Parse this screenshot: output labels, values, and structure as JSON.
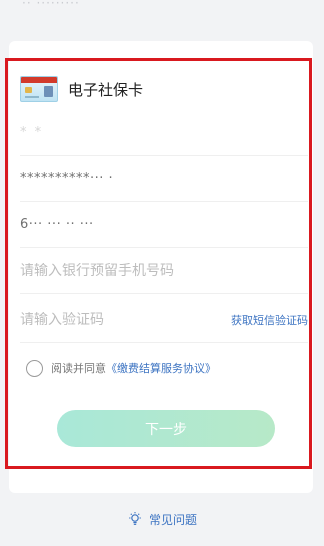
{
  "card": {
    "title": "电子社保卡"
  },
  "fields": {
    "name_masked": "* *",
    "id_number_masked": "**********··· ·",
    "bank_card_masked": "6··· ··· ·· ···",
    "phone_placeholder": "请输入银行预留手机号码",
    "code_placeholder": "请输入验证码",
    "sms_button": "获取短信验证码"
  },
  "agreement": {
    "text": "阅读并同意",
    "link": "《缴费结算服务协议》"
  },
  "next_button": "下一步",
  "faq": {
    "label": "常见问题",
    "icon": "lightbulb-icon"
  },
  "colors": {
    "accent": "#3d74c2",
    "highlight_border": "#d9191f",
    "button_gradient_start": "#a9e8d8",
    "button_gradient_end": "#b7e9c8"
  }
}
